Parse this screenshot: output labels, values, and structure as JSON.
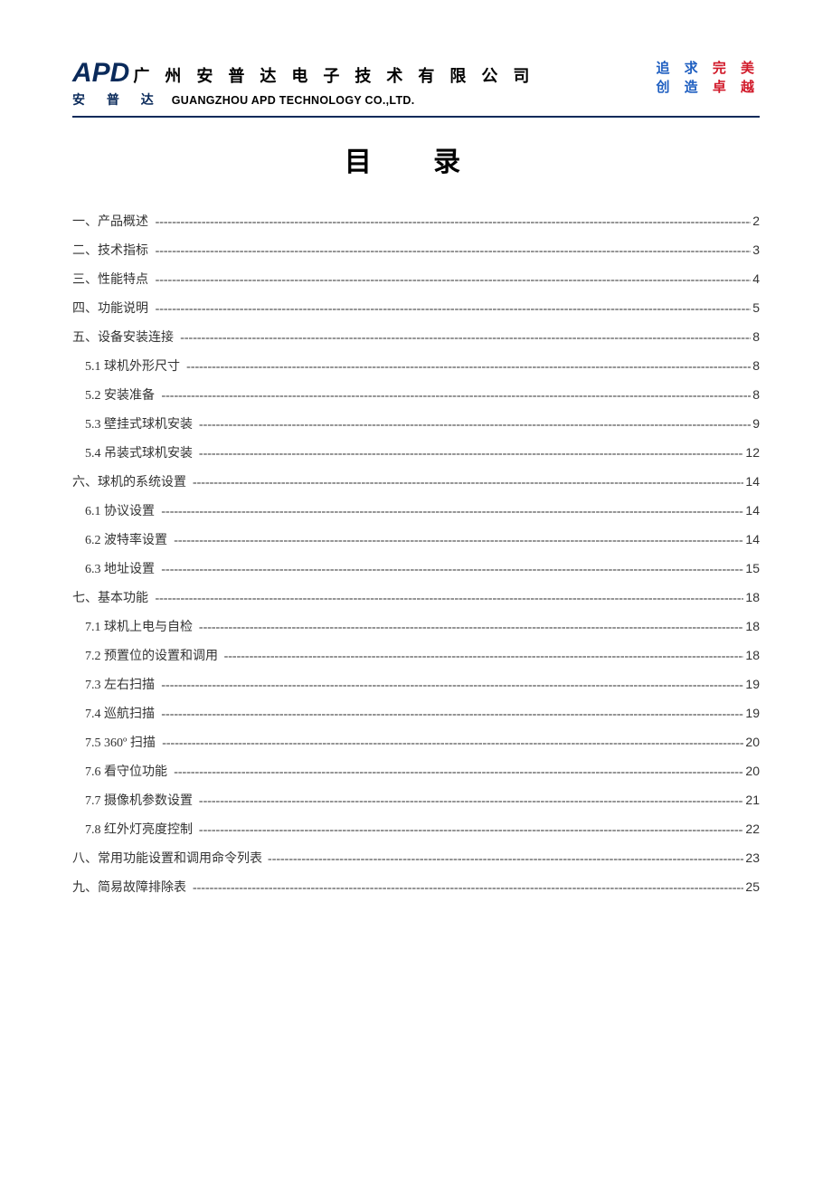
{
  "header": {
    "logo_mark": "APD",
    "cn_company": "广 州 安 普 达 电 子 技 术 有 限 公 司",
    "cn_brand": "安 普 达",
    "en_company": "GUANGZHOU APD TECHNOLOGY CO.,LTD.",
    "slogan_l1_a": "追 求",
    "slogan_l1_b": "完 美",
    "slogan_l2_a": "创 造",
    "slogan_l2_b": "卓 越"
  },
  "title": "目 录",
  "toc": [
    {
      "label": "一、产品概述",
      "page": "2",
      "indent": false
    },
    {
      "label": "二、技术指标",
      "page": "3",
      "indent": false
    },
    {
      "label": "三、性能特点",
      "page": "4",
      "indent": false
    },
    {
      "label": "四、功能说明",
      "page": "5",
      "indent": false
    },
    {
      "label": "五、设备安装连接",
      "page": "8",
      "indent": false
    },
    {
      "label": "5.1 球机外形尺寸",
      "page": "8",
      "indent": true
    },
    {
      "label": "5.2 安装准备",
      "page": "8",
      "indent": true
    },
    {
      "label": "5.3 壁挂式球机安装",
      "page": "9",
      "indent": true
    },
    {
      "label": "5.4 吊装式球机安装",
      "page": "12",
      "indent": true
    },
    {
      "label": "六、球机的系统设置",
      "page": "14",
      "indent": false
    },
    {
      "label": "6.1 协议设置",
      "page": "14",
      "indent": true
    },
    {
      "label": "6.2 波特率设置",
      "page": "14",
      "indent": true
    },
    {
      "label": "6.3 地址设置",
      "page": "15",
      "indent": true
    },
    {
      "label": "七、基本功能",
      "page": "18",
      "indent": false
    },
    {
      "label": "7.1 球机上电与自检",
      "page": "18",
      "indent": true
    },
    {
      "label": "7.2 预置位的设置和调用",
      "page": "18",
      "indent": true
    },
    {
      "label": "7.3 左右扫描",
      "page": "19",
      "indent": true
    },
    {
      "label": "7.4 巡航扫描",
      "page": "19",
      "indent": true
    },
    {
      "label": "7.5 360º 扫描",
      "page": "20",
      "indent": true
    },
    {
      "label": "7.6 看守位功能",
      "page": "20",
      "indent": true
    },
    {
      "label": "7.7 摄像机参数设置",
      "page": "21",
      "indent": true
    },
    {
      "label": "7.8 红外灯亮度控制",
      "page": "22",
      "indent": true
    },
    {
      "label": "八、常用功能设置和调用命令列表",
      "page": "23",
      "indent": false
    },
    {
      "label": "九、简易故障排除表",
      "page": "25",
      "indent": false
    }
  ]
}
